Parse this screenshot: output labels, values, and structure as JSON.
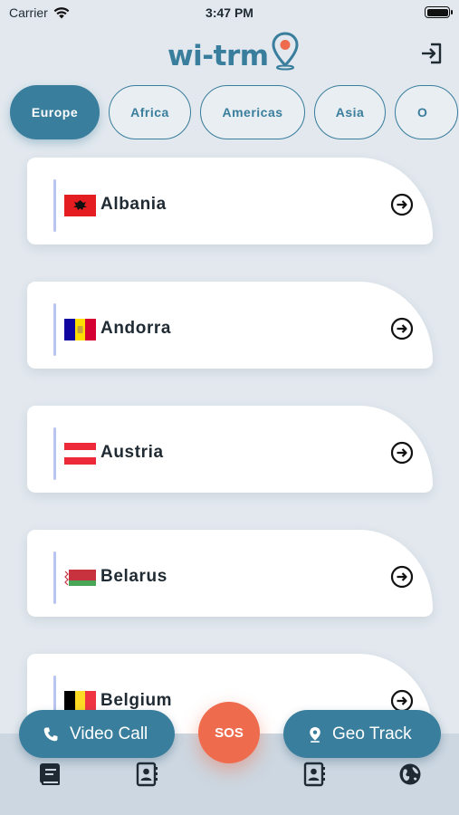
{
  "status_bar": {
    "carrier": "Carrier",
    "time": "3:47 PM"
  },
  "header": {
    "logo_text": "wi-trm",
    "logout_icon": "logout-icon"
  },
  "tabs": [
    {
      "label": "Europe",
      "active": true
    },
    {
      "label": "Africa",
      "active": false
    },
    {
      "label": "Americas",
      "active": false
    },
    {
      "label": "Asia",
      "active": false
    },
    {
      "label": "O",
      "active": false
    }
  ],
  "countries": [
    {
      "name": "Albania",
      "flag": "albania-flag"
    },
    {
      "name": "Andorra",
      "flag": "andorra-flag"
    },
    {
      "name": "Austria",
      "flag": "austria-flag"
    },
    {
      "name": "Belarus",
      "flag": "belarus-flag"
    },
    {
      "name": "Belgium",
      "flag": "belgium-flag"
    }
  ],
  "actions": {
    "video_call": "Video Call",
    "sos": "SOS",
    "geo_track": "Geo Track"
  },
  "bottom_nav": [
    "book-icon",
    "contacts-icon",
    "contacts-icon",
    "globe-icon"
  ],
  "colors": {
    "primary": "#3a7e9d",
    "sos": "#ee6c4d",
    "background": "#e2e8ee",
    "nav_bar": "#ccd7e1"
  }
}
